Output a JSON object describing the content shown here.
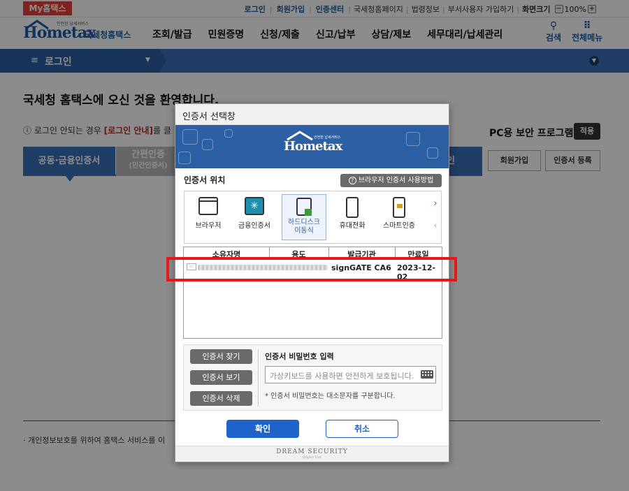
{
  "topbar": {
    "my_hometax": "My홈택스",
    "links": [
      "로그인",
      "회원가입",
      "인증센터"
    ],
    "plain_links": [
      "국세청홈페이지",
      "법령정보",
      "부서사용자 가입하기"
    ],
    "font_size_label": "화면크기",
    "zoom_minus": "−",
    "zoom_value": "100%",
    "zoom_plus": "+"
  },
  "header": {
    "logo_small": "안전한 납세서비스",
    "logo_text": "Hometax",
    "logo_suffix": "국세청홈택스",
    "nav": [
      "조회/발급",
      "민원증명",
      "신청/제출",
      "신고/납부",
      "상담/제보",
      "세무대리/납세관리"
    ],
    "search_label": "검색",
    "menu_label": "전체메뉴"
  },
  "navstrip": {
    "title": "로그인"
  },
  "page": {
    "welcome": "국세청 홈택스에 오신 것을 환영합니다.",
    "notice_prefix": "로그인 안되는 경우",
    "notice_link": "[로그인 안내]",
    "notice_suffix": "를 클",
    "pc_security": "PC용 보안 프로그램",
    "apply": "적용",
    "tab1": "공동·금융인증서",
    "tab2": "간편인증",
    "tab2_sub": "(민간인증서)",
    "tab3": "그인",
    "join_btn": "회원가입",
    "cert_reg_btn": "인증서 등록",
    "privacy": "· 개인정보보호를 위하여 홈택스 서비스를 이"
  },
  "modal": {
    "title": "인증서 선택창",
    "banner_logo": "Hometax",
    "banner_small": "안전한 납세서비스",
    "location_title": "인증서 위치",
    "howto": "브라우저 인증서 사용방법",
    "locations": [
      {
        "label": "브라우저"
      },
      {
        "label": "금융인증서"
      },
      {
        "label": "하드디스크\n이동식"
      },
      {
        "label": "휴대전화"
      },
      {
        "label": "스마트인증"
      }
    ],
    "nav_next": "›",
    "nav_prev": "‹",
    "columns": [
      "소유자명",
      "용도",
      "발급기관",
      "만료일"
    ],
    "rows": [
      {
        "owner": "",
        "purpose": "",
        "issuer": "signGATE CA6",
        "expiry": "2023-12-02"
      }
    ],
    "find_btn": "인증서 찾기",
    "view_btn": "인증서 보기",
    "delete_btn": "인증서 삭제",
    "pw_label": "인증서 비밀번호 입력",
    "pw_placeholder": "가상키보드를 사용하면 안전하게 보호됩니다.",
    "pw_note": "* 인증서 비밀번호는 대소문자를 구분합니다.",
    "ok": "확인",
    "cancel": "취소",
    "footer": "DREAM SECURITY",
    "footer_sub": "Original Trust"
  },
  "colors": {
    "brand_blue": "#2d5fa5",
    "accent_red": "#e8413b",
    "highlight_red": "#e8181a",
    "ok_blue": "#1d63c9"
  }
}
